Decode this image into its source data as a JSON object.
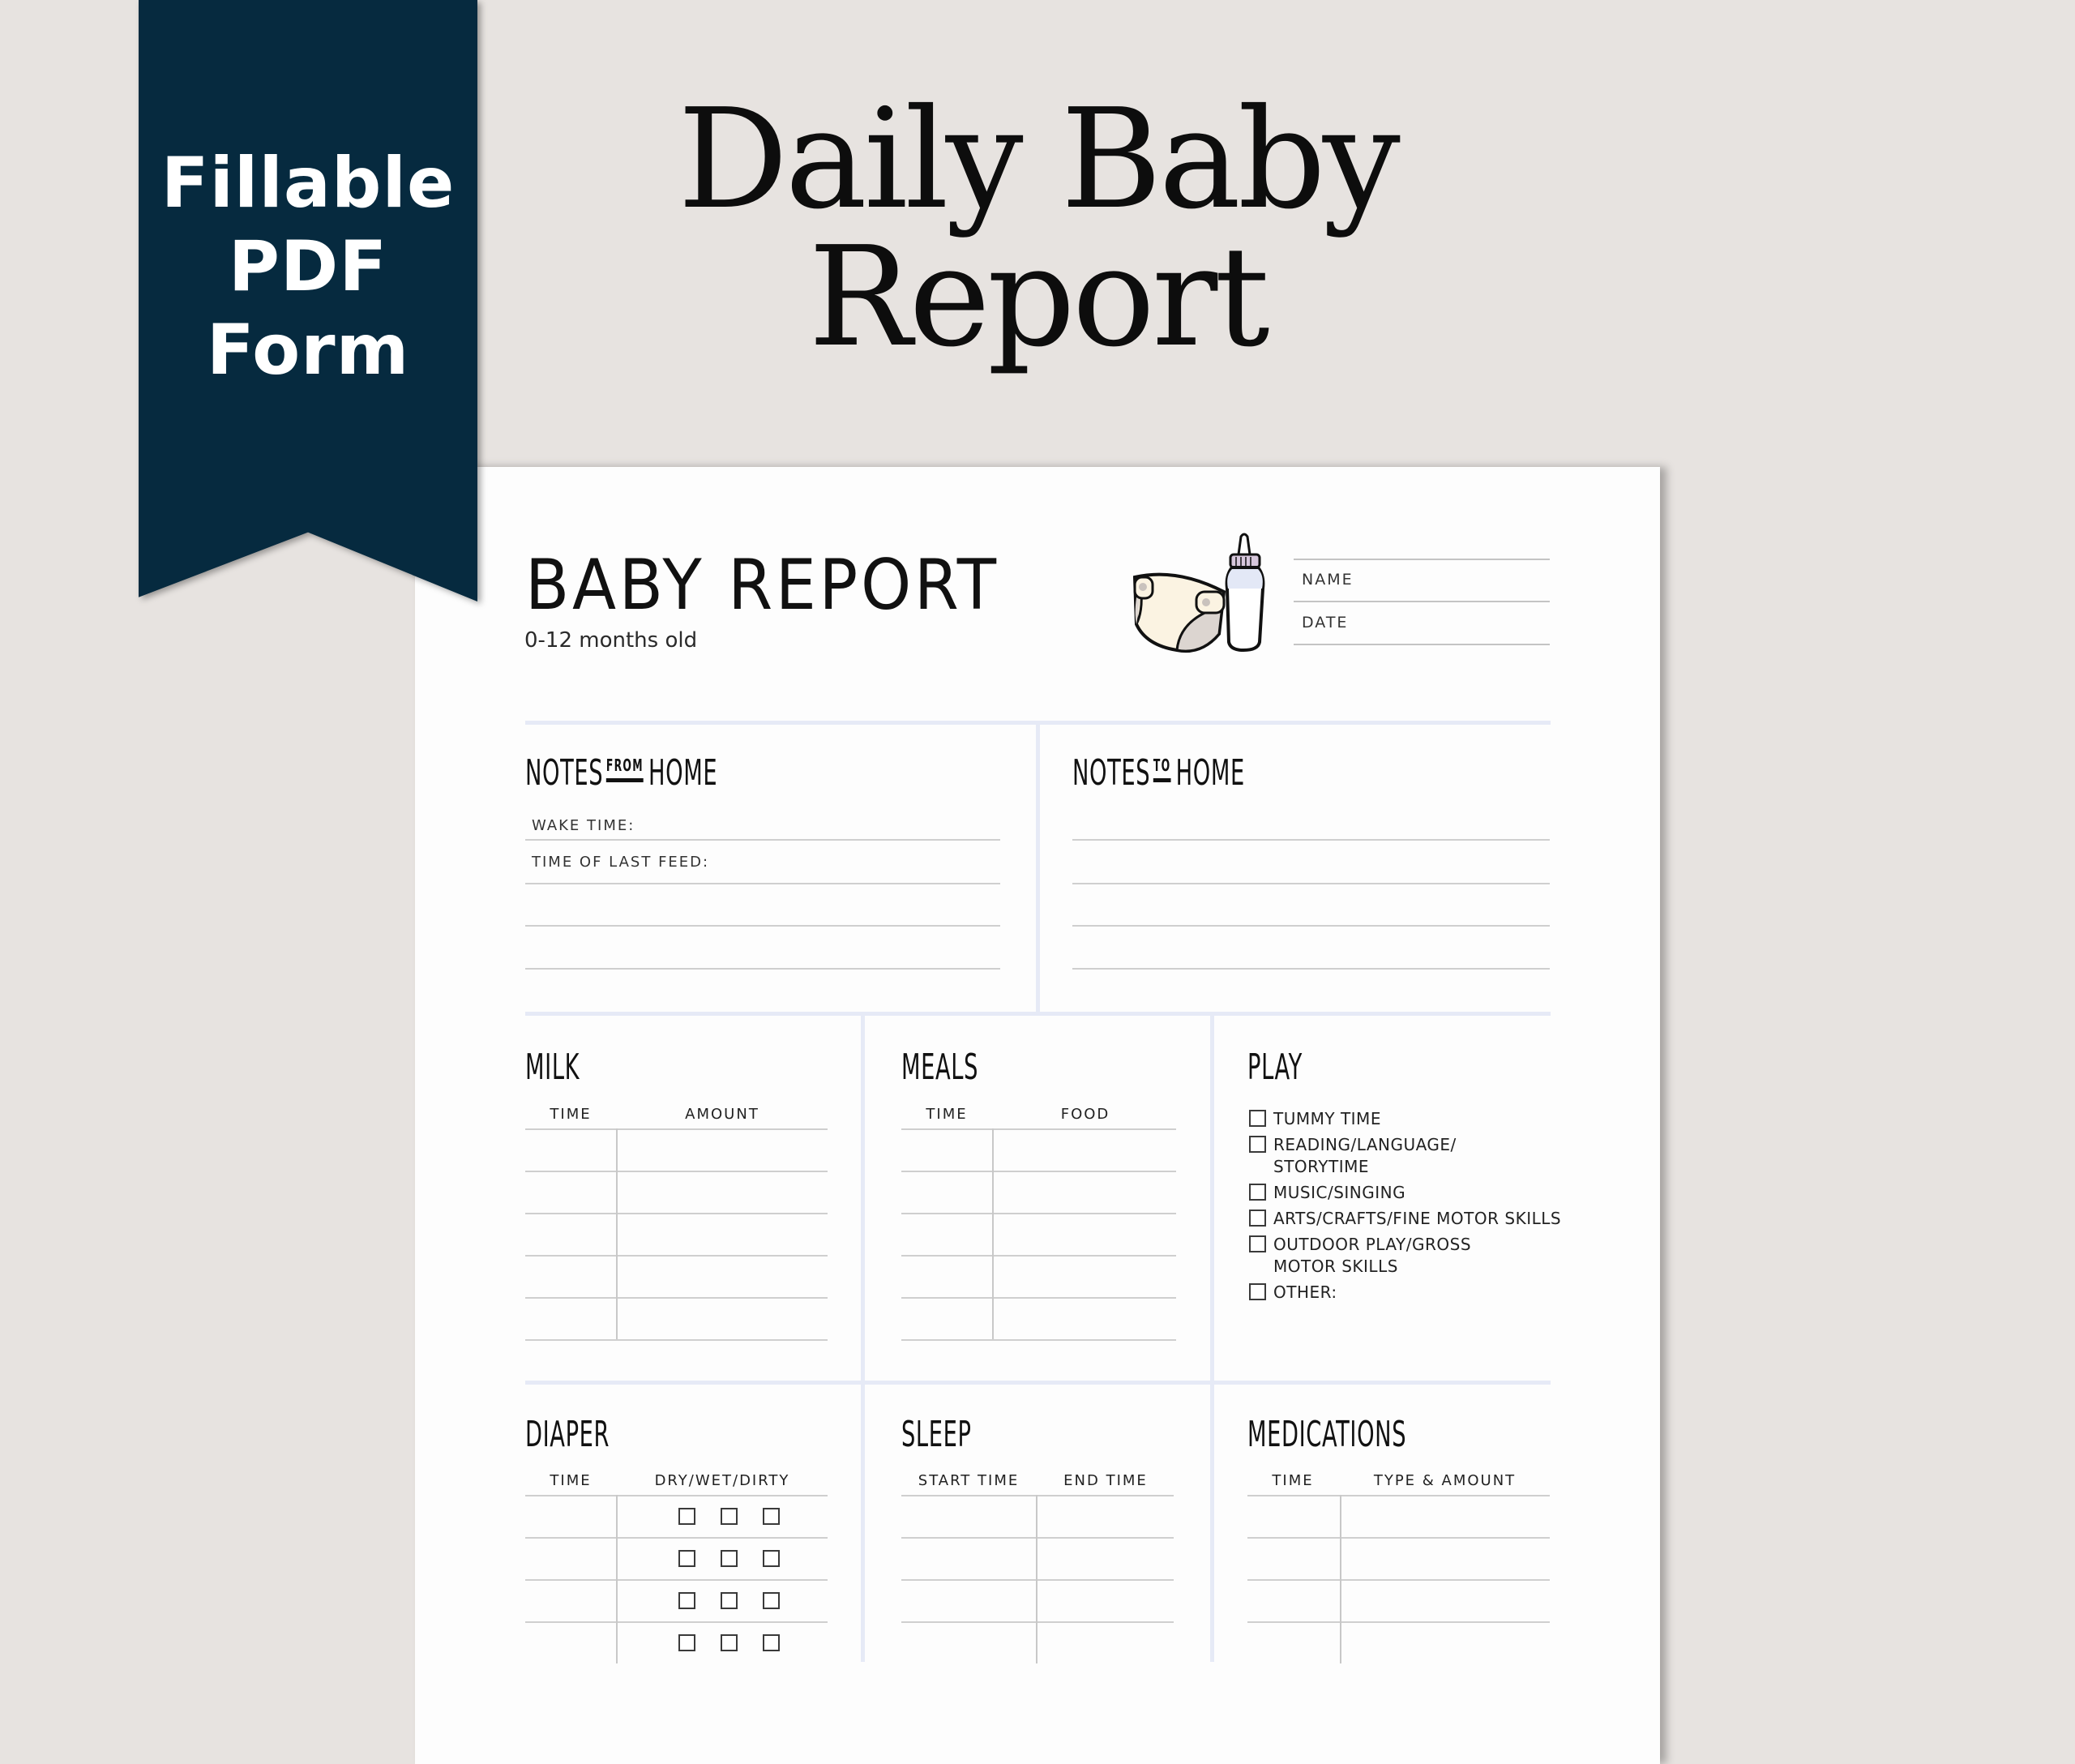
{
  "banner": {
    "lines": [
      "Fillable",
      "PDF",
      "Form"
    ],
    "color": "#062a3f"
  },
  "headline": {
    "lines": [
      "Daily Baby",
      "Report"
    ]
  },
  "form": {
    "title": "BABY REPORT",
    "subtitle": "0-12 months old",
    "icons": [
      "diaper-icon",
      "baby-bottle-icon"
    ],
    "fields": {
      "name_label": "NAME",
      "date_label": "DATE"
    },
    "notes_from_home": {
      "title_pre": "NOTES",
      "title_small": "FROM",
      "title_post": "HOME",
      "lines": [
        "WAKE TIME:",
        "TIME OF LAST FEED:",
        "",
        ""
      ]
    },
    "notes_to_home": {
      "title_pre": "NOTES",
      "title_small": "TO",
      "title_post": "HOME",
      "lines": [
        "",
        "",
        "",
        ""
      ]
    },
    "milk": {
      "title": "MILK",
      "columns": [
        "TIME",
        "AMOUNT"
      ],
      "rows": 5
    },
    "meals": {
      "title": "MEALS",
      "columns": [
        "TIME",
        "FOOD"
      ],
      "rows": 5
    },
    "play": {
      "title": "PLAY",
      "items": [
        {
          "label": [
            "TUMMY TIME"
          ],
          "checked": false
        },
        {
          "label": [
            "READING/LANGUAGE/",
            "STORYTIME"
          ],
          "checked": false
        },
        {
          "label": [
            "MUSIC/SINGING"
          ],
          "checked": false
        },
        {
          "label": [
            "ARTS/CRAFTS/FINE MOTOR SKILLS"
          ],
          "checked": false
        },
        {
          "label": [
            "OUTDOOR PLAY/GROSS",
            "MOTOR SKILLS"
          ],
          "checked": false
        },
        {
          "label": [
            "OTHER:"
          ],
          "checked": false
        }
      ]
    },
    "diaper": {
      "title": "DIAPER",
      "columns": [
        "TIME",
        "DRY/WET/DIRTY"
      ],
      "rows_visible": 4
    },
    "sleep": {
      "title": "SLEEP",
      "columns": [
        "START TIME",
        "END TIME"
      ],
      "rows_visible": 4
    },
    "medications": {
      "title": "MEDICATIONS",
      "columns": [
        "TIME",
        "TYPE & AMOUNT"
      ],
      "rows_visible": 4
    }
  }
}
